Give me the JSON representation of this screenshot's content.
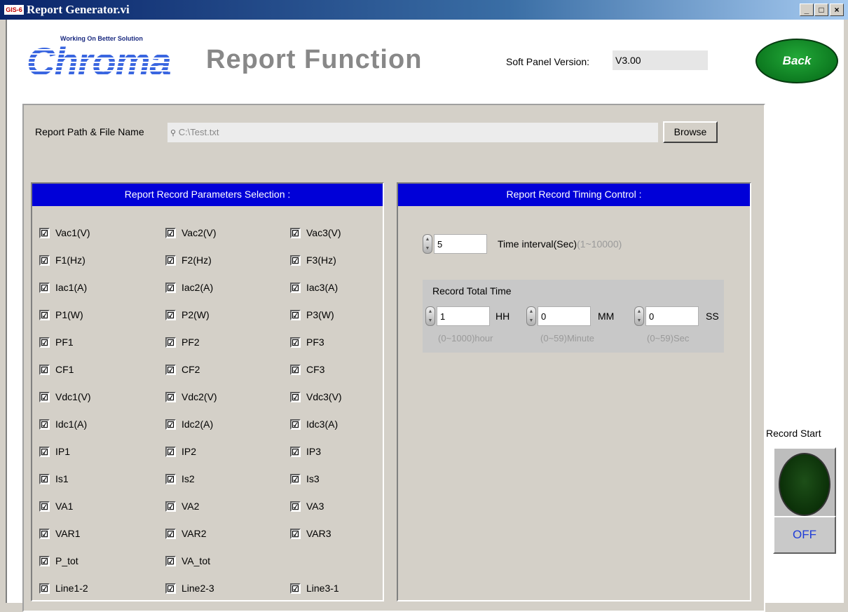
{
  "window": {
    "app_icon": "GIS-6",
    "title": "Report Generator.vi",
    "buttons": [
      "_",
      "□",
      "×"
    ]
  },
  "logo": {
    "word": "Chroma",
    "tagline": "Working On Better Solution"
  },
  "header": {
    "title": "Report Function",
    "version_label": "Soft Panel Version:",
    "version_value": "V3.00",
    "back_label": "Back"
  },
  "path": {
    "label": "Report Path & File Name",
    "value": "C:\\Test.txt",
    "browse_label": "Browse"
  },
  "params": {
    "header": "Report Record Parameters Selection :",
    "columns": [
      [
        "Vac1(V)",
        "F1(Hz)",
        "Iac1(A)",
        "P1(W)",
        "PF1",
        "CF1",
        "Vdc1(V)",
        "Idc1(A)",
        "IP1",
        "Is1",
        "VA1",
        "VAR1",
        "P_tot",
        "Line1-2"
      ],
      [
        "Vac2(V)",
        "F2(Hz)",
        "Iac2(A)",
        "P2(W)",
        "PF2",
        "CF2",
        "Vdc2(V)",
        "Idc2(A)",
        "IP2",
        "Is2",
        "VA2",
        "VAR2",
        "VA_tot",
        "Line2-3"
      ],
      [
        "Vac3(V)",
        "F3(Hz)",
        "Iac3(A)",
        "P3(W)",
        "PF3",
        "CF3",
        "Vdc3(V)",
        "Idc3(A)",
        "IP3",
        "Is3",
        "VA3",
        "VAR3",
        "",
        "Line3-1"
      ]
    ],
    "checked": "☑"
  },
  "timing": {
    "header": "Report Record Timing Control :",
    "interval_value": "5",
    "interval_label": "Time interval(Sec)",
    "interval_hint": "(1~10000)",
    "total_label": "Record Total Time",
    "hh_value": "1",
    "hh_label": "HH",
    "hh_hint": "(0~1000)hour",
    "mm_value": "0",
    "mm_label": "MM",
    "mm_hint": "(0~59)Minute",
    "ss_value": "0",
    "ss_label": "SS",
    "ss_hint": "(0~59)Sec"
  },
  "record": {
    "label": "Record Start",
    "state": "OFF"
  }
}
